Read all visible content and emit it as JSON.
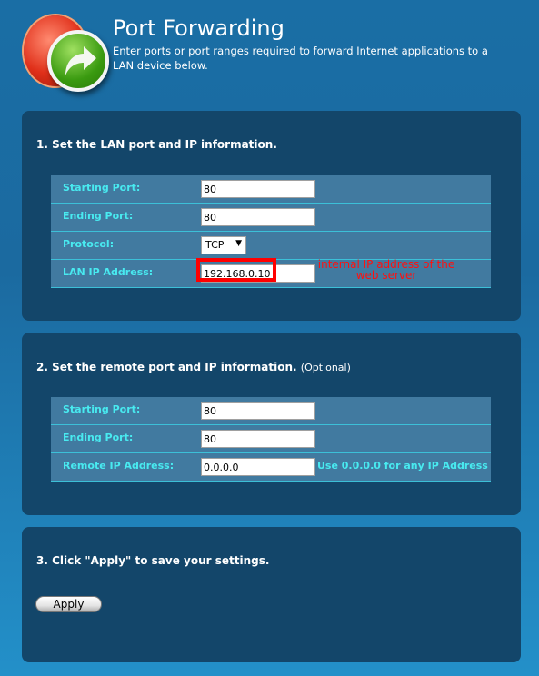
{
  "header": {
    "title": "Port Forwarding",
    "subtitle": "Enter ports or port ranges required to forward Internet applications to a LAN device below.",
    "logo_icon": "forward-arrow-icon"
  },
  "section1": {
    "heading": "1. Set the LAN port and IP information.",
    "starting_port_label": "Starting Port:",
    "starting_port": "80",
    "ending_port_label": "Ending Port:",
    "ending_port": "80",
    "protocol_label": "Protocol:",
    "protocol": "TCP",
    "lan_ip_label": "LAN IP Address:",
    "lan_ip": "192.168.0.10",
    "annotation": "internal IP address of the web server",
    "annotation_color": "#ff0000"
  },
  "section2": {
    "heading": "2. Set the remote port and IP information.",
    "optional": "(Optional)",
    "starting_port_label": "Starting Port:",
    "starting_port": "80",
    "ending_port_label": "Ending Port:",
    "ending_port": "80",
    "remote_ip_label": "Remote IP Address:",
    "remote_ip": "0.0.0.0",
    "remote_ip_hint": "Use 0.0.0.0 for any IP Address"
  },
  "section3": {
    "heading": "3. Click \"Apply\" to save your settings.",
    "apply_label": "Apply"
  }
}
